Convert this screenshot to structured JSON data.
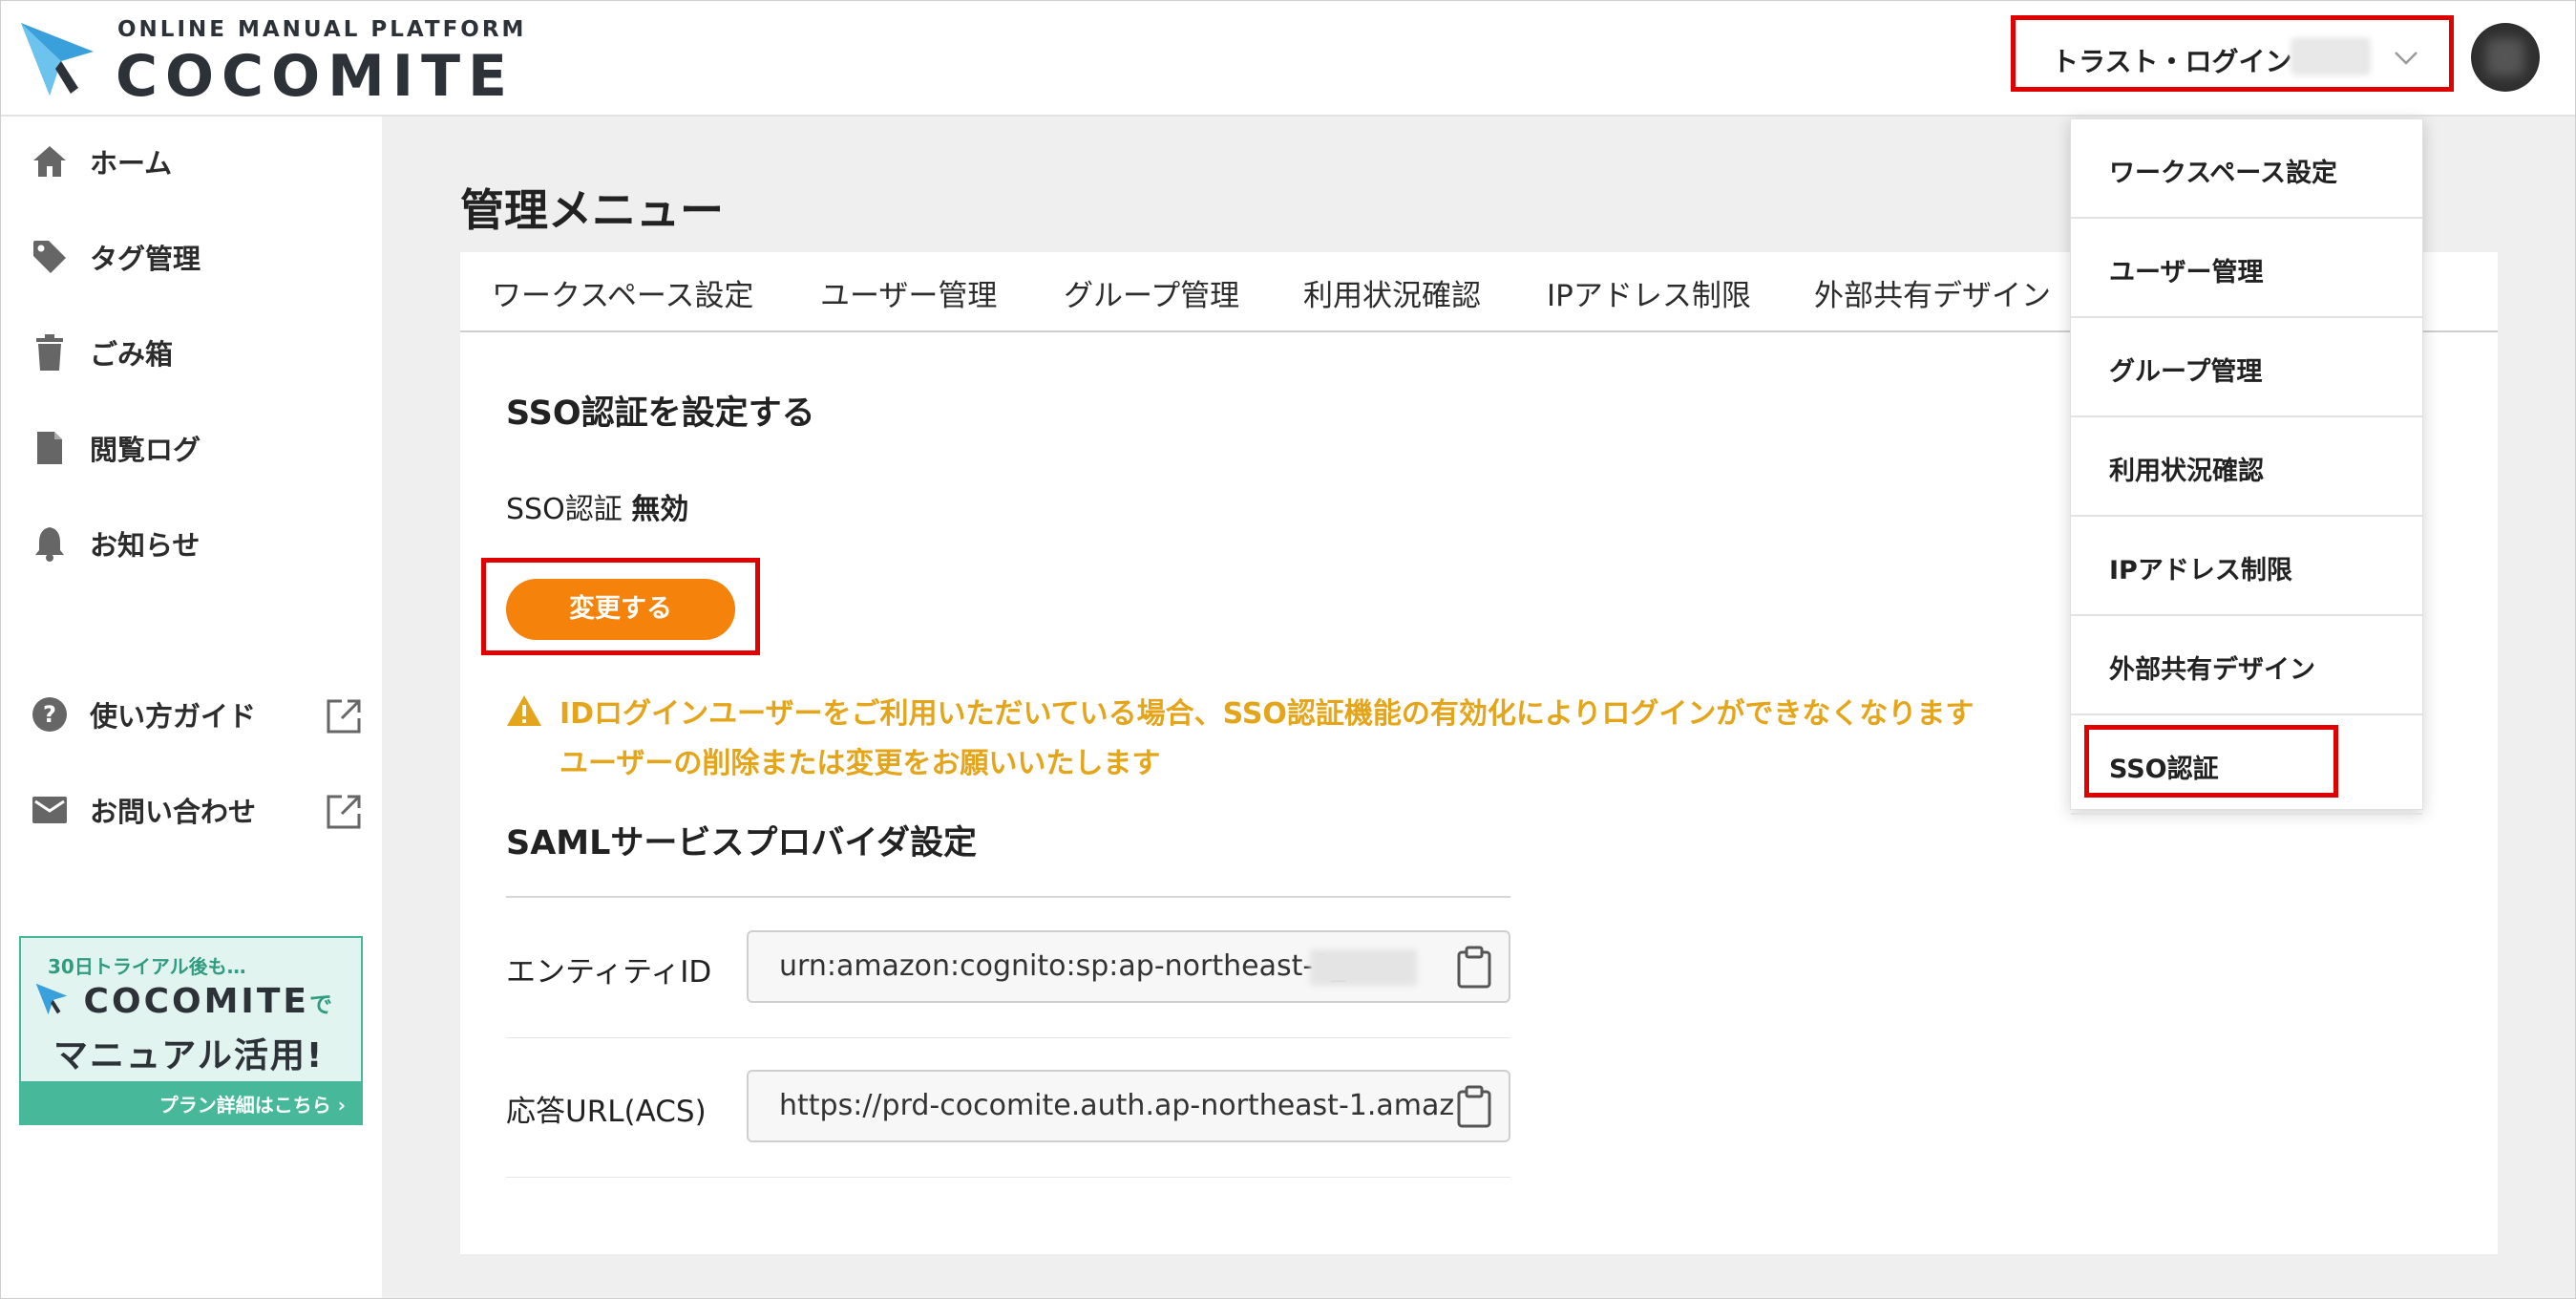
{
  "brand": {
    "subtitle": "ONLINE MANUAL PLATFORM",
    "name": "COCOMITE"
  },
  "account": {
    "name": "トラスト・ログイン"
  },
  "sidebar": {
    "items": [
      {
        "label": "ホーム",
        "icon": "home-icon"
      },
      {
        "label": "タグ管理",
        "icon": "tag-icon"
      },
      {
        "label": "ごみ箱",
        "icon": "trash-icon"
      },
      {
        "label": "閲覧ログ",
        "icon": "document-icon"
      },
      {
        "label": "お知らせ",
        "icon": "bell-icon"
      }
    ],
    "external": [
      {
        "label": "使い方ガイド",
        "icon": "help-icon"
      },
      {
        "label": "お問い合わせ",
        "icon": "mail-icon"
      }
    ],
    "banner": {
      "top": "30日トライアル後も…",
      "logo": "COCOMITE",
      "logo_suffix": "で",
      "main": "マニュアル活用!",
      "link": "プラン詳細はこちら ›"
    }
  },
  "main": {
    "title": "管理メニュー",
    "tabs": [
      "ワークスペース設定",
      "ユーザー管理",
      "グループ管理",
      "利用状況確認",
      "IPアドレス制限",
      "外部共有デザイン"
    ],
    "sso": {
      "heading": "SSO認証を設定する",
      "status_label": "SSO認証",
      "status_value": "無効",
      "change_button": "変更する",
      "warning_line1": "IDログインユーザーをご利用いただいている場合、SSO認証機能の有効化によりログインができなくなります",
      "warning_line2": "ユーザーの削除または変更をお願いいたします"
    },
    "saml": {
      "heading": "SAMLサービスプロバイダ設定",
      "fields": [
        {
          "label": "エンティティID",
          "value": "urn:amazon:cognito:sp:ap-northeast-1_"
        },
        {
          "label": "応答URL(ACS)",
          "value": "https://prd-cocomite.auth.ap-northeast-1.amaz"
        }
      ]
    }
  },
  "dropdown": {
    "items": [
      "ワークスペース設定",
      "ユーザー管理",
      "グループ管理",
      "利用状況確認",
      "IPアドレス制限",
      "外部共有デザイン",
      "SSO認証"
    ]
  },
  "colors": {
    "accent_orange": "#f5820b",
    "warning": "#e4a51a",
    "highlight_red": "#e00000",
    "brand_teal": "#48b89a",
    "logo_blue": "#3aa0dc"
  }
}
